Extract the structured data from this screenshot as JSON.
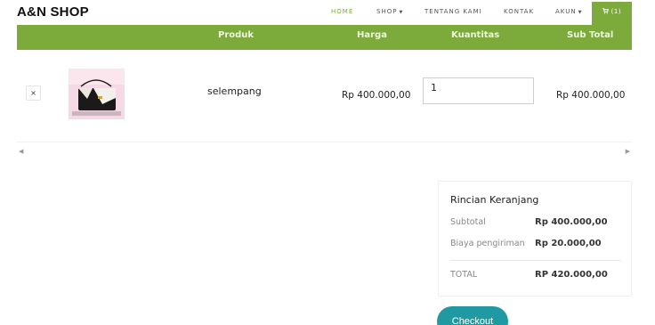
{
  "header": {
    "brand": "A&N SHOP",
    "nav": {
      "home": "HOME",
      "shop": "SHOP",
      "about": "TENTANG KAMI",
      "contact": "KONTAK",
      "account": "AKUN",
      "cart": "(1)"
    }
  },
  "table": {
    "columns": [
      "Produk",
      "Harga",
      "Kuantitas",
      "Sub Total"
    ],
    "rows": [
      {
        "remove": "×",
        "product": "selempang",
        "price": "Rp 400.000,00",
        "quantity": "1",
        "subtotal": "Rp 400.000,00"
      }
    ]
  },
  "summary": {
    "title": "Rincian Keranjang",
    "subtotal_label": "Subtotal",
    "subtotal_value": "Rp 400.000,00",
    "shipping_label": "Biaya pengiriman",
    "shipping_value": "Rp 20.000,00",
    "total_label": "TOTAL",
    "total_value": "RP 420.000,00"
  },
  "checkout_label": "Checkout",
  "colors": {
    "accent": "#7cab3c",
    "checkout": "#1f9aa3"
  },
  "icons": [
    "cart-icon",
    "close-icon",
    "caret-down-icon",
    "scroll-left-icon",
    "scroll-right-icon"
  ]
}
